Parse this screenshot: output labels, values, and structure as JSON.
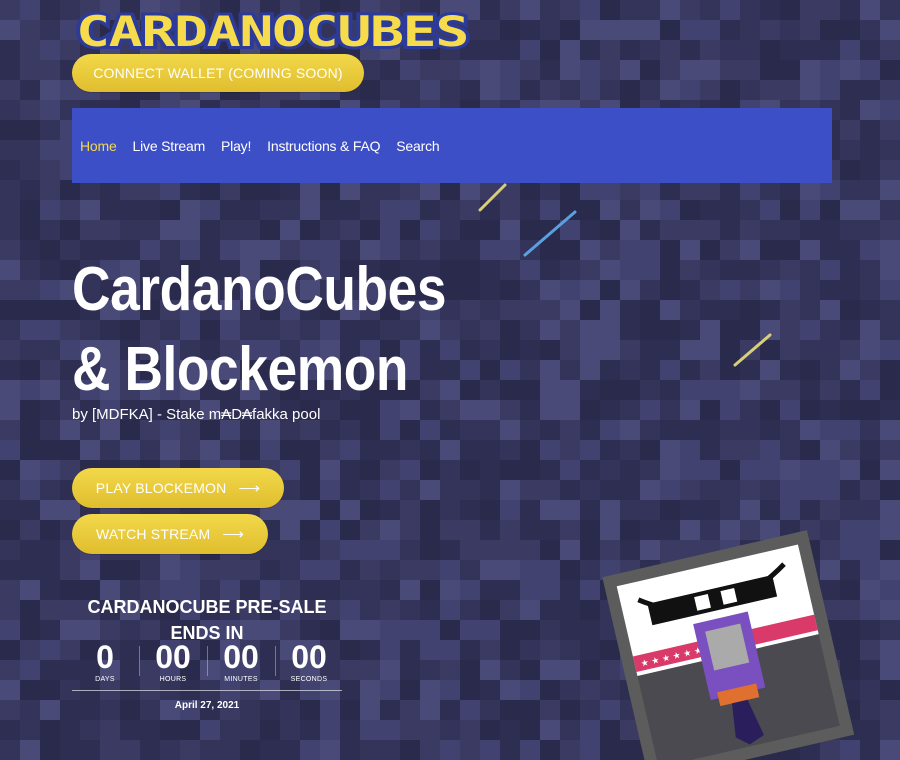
{
  "logo": {
    "text": "CARDANOCUBES"
  },
  "header": {
    "connect_wallet_label": "CONNECT WALLET (COMING SOON)"
  },
  "nav": {
    "items": [
      {
        "label": "Home",
        "active": true
      },
      {
        "label": "Live Stream",
        "active": false
      },
      {
        "label": "Play!",
        "active": false
      },
      {
        "label": "Instructions & FAQ",
        "active": false
      },
      {
        "label": "Search",
        "active": false
      }
    ]
  },
  "hero": {
    "title_line1": "CardanoCubes",
    "title_line2": "& Blockemon",
    "subtitle": "by [MDFKA] - Stake m₳D₳fakka pool",
    "play_label": "PLAY BLOCKEMON",
    "watch_label": "WATCH STREAM",
    "arrow_icon": "arrow-right-icon"
  },
  "presale": {
    "title": "CARDANOCUBE PRE-SALE ENDS IN",
    "countdown": [
      {
        "value": "0",
        "label": "DAYS"
      },
      {
        "value": "00",
        "label": "HOURS"
      },
      {
        "value": "00",
        "label": "MINUTES"
      },
      {
        "value": "00",
        "label": "SECONDS"
      }
    ],
    "date": "April 27, 2021"
  },
  "colors": {
    "accent_yellow": "#f2d94a",
    "nav_blue": "#3d4fc6",
    "background": "#34345a"
  }
}
